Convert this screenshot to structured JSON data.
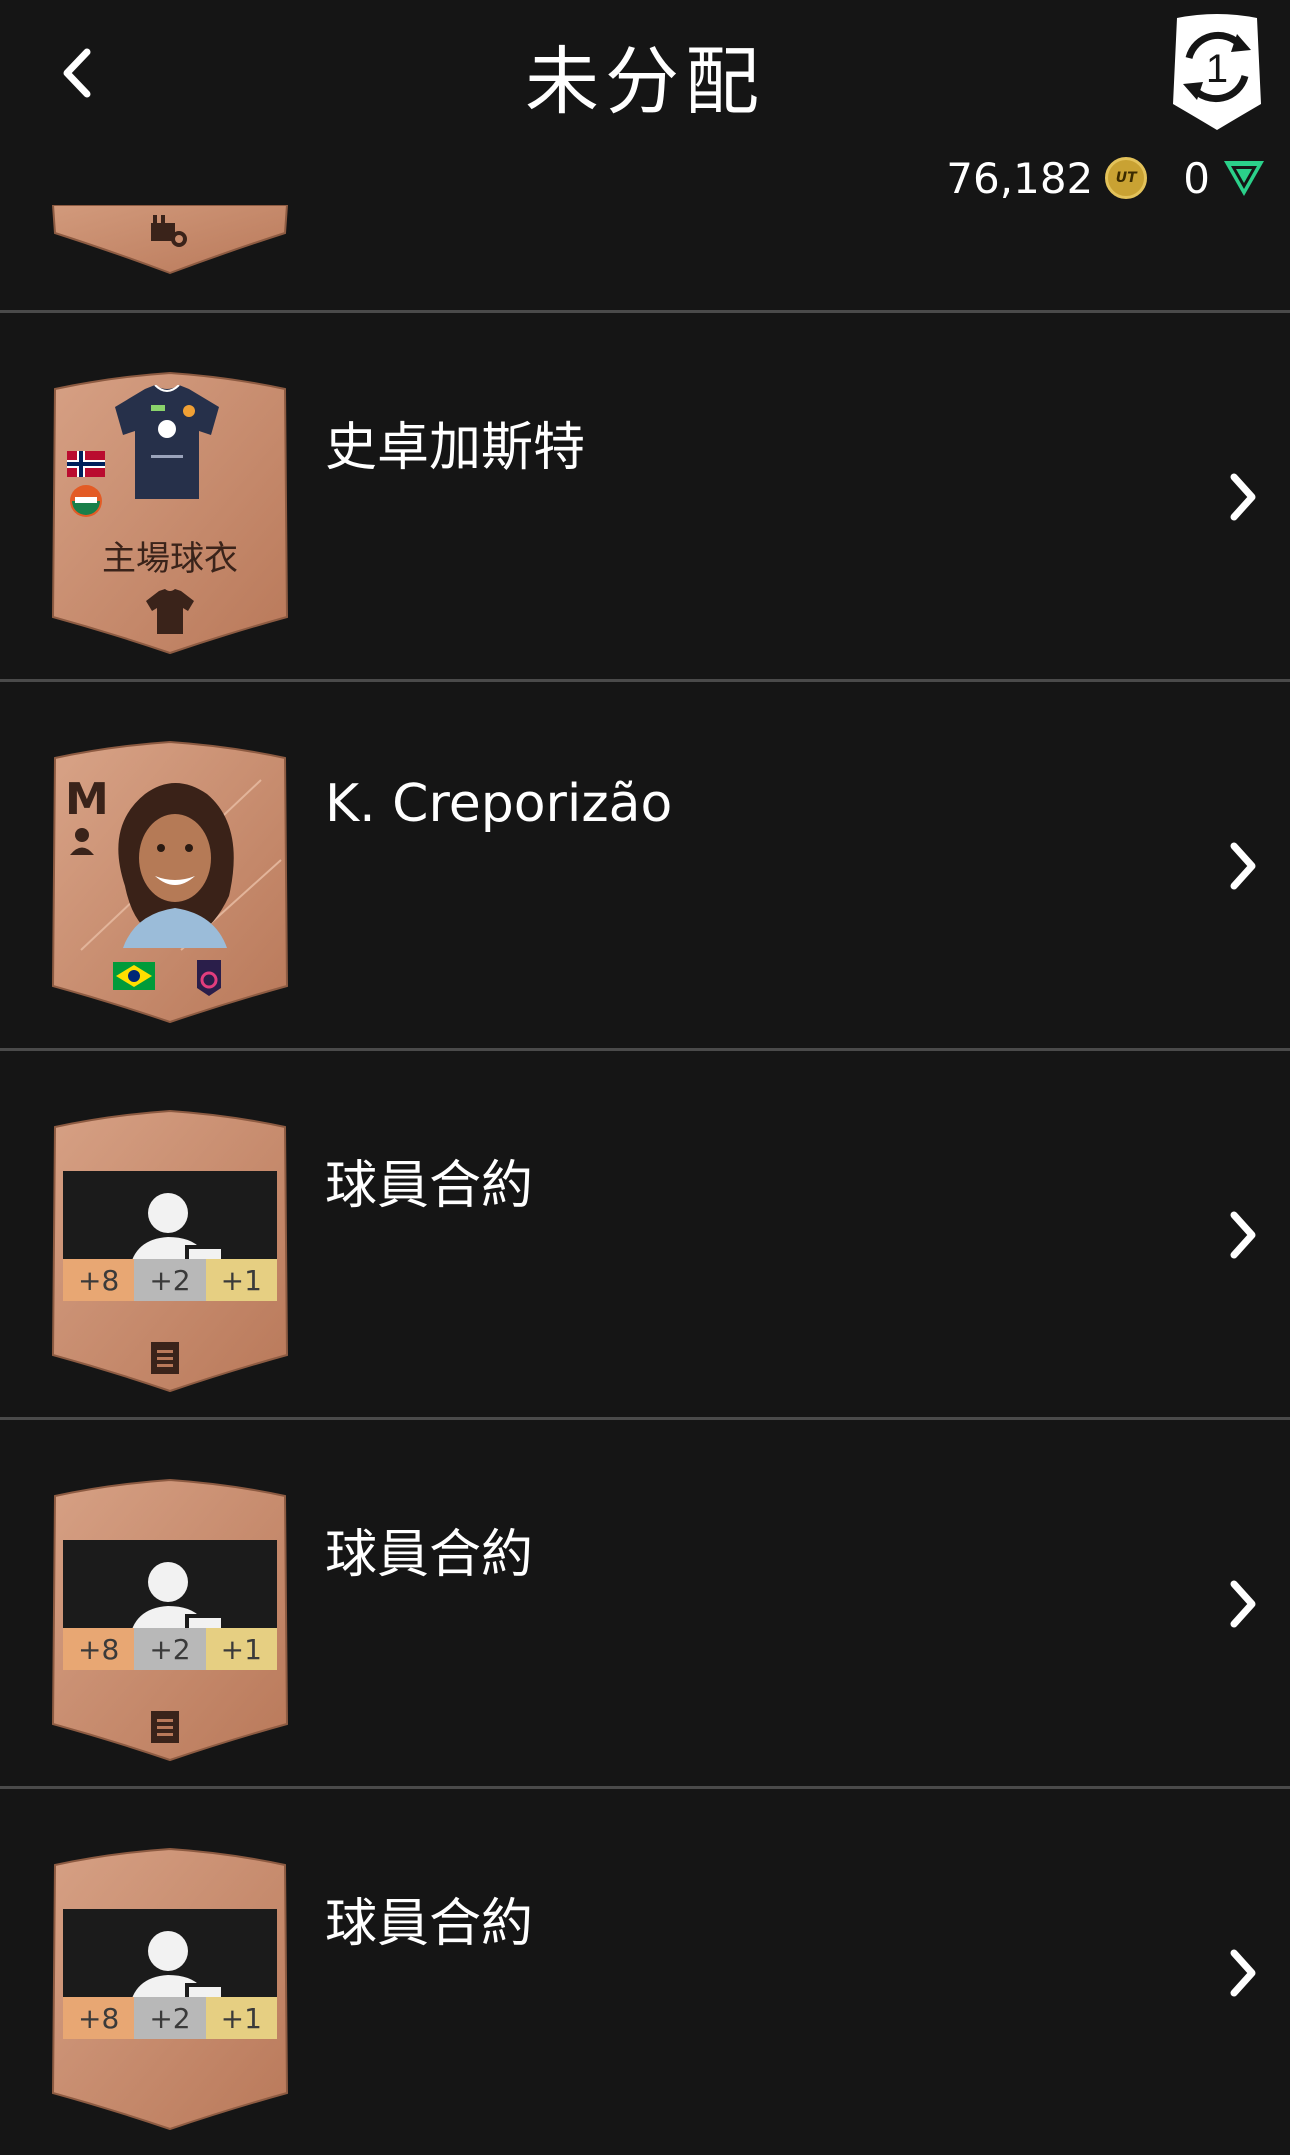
{
  "header": {
    "title": "未分配",
    "refresh_count": "1",
    "coins": "76,182",
    "coin_icon_text": "UT",
    "points": "0"
  },
  "colors": {
    "background": "#151515",
    "card_bronze": "#c98c6d",
    "badge_bronze": "#e8a773",
    "badge_silver": "#b8b8b8",
    "badge_gold": "#e6cf82"
  },
  "rows": [
    {
      "label": "史卓加斯特",
      "card_type": "kit",
      "card_caption": "主場球衣",
      "icons": [
        "norway-flag",
        "club-crest",
        "jersey-icon"
      ]
    },
    {
      "label": "K. Creporizão",
      "card_type": "player",
      "position": "M",
      "icons": [
        "brazil-flag",
        "league-crest"
      ]
    },
    {
      "label": "球員合約",
      "card_type": "contract",
      "badges": [
        "+8",
        "+2",
        "+1"
      ]
    },
    {
      "label": "球員合約",
      "card_type": "contract",
      "badges": [
        "+8",
        "+2",
        "+1"
      ]
    },
    {
      "label": "球員合約",
      "card_type": "contract",
      "badges": [
        "+8",
        "+2",
        "+1"
      ]
    }
  ]
}
